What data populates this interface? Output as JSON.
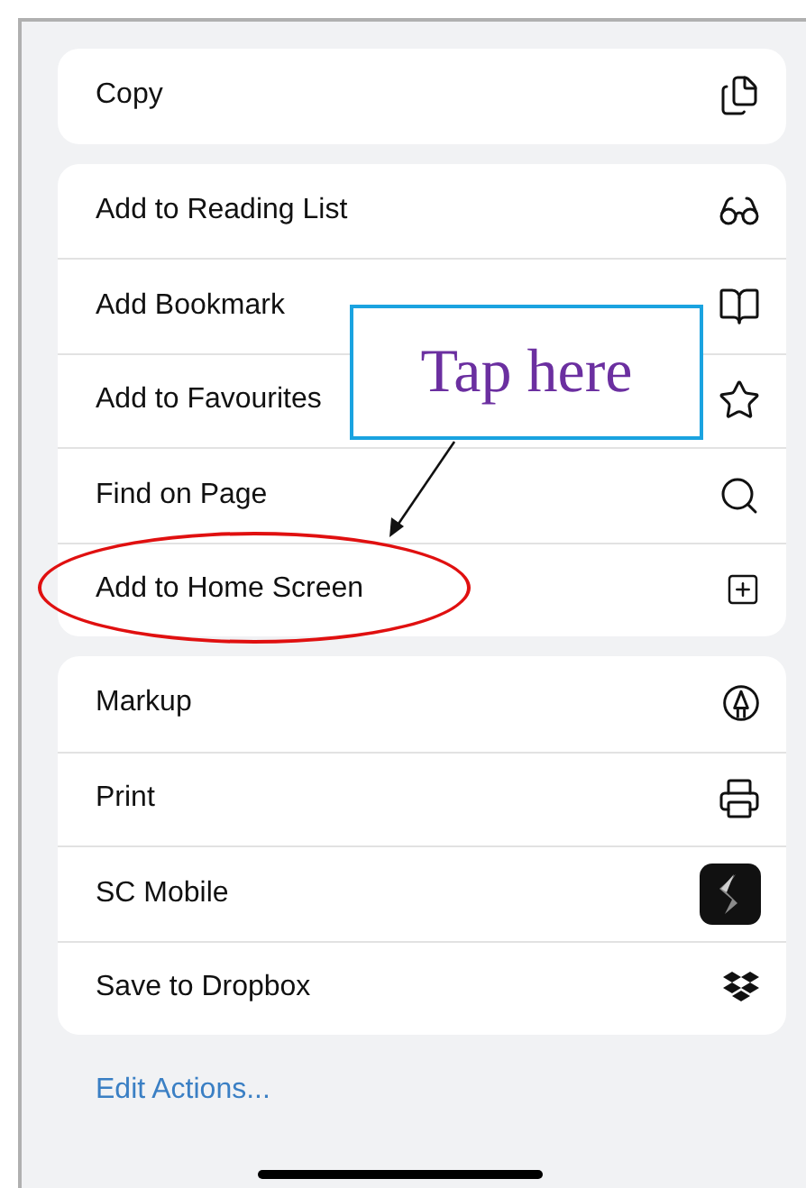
{
  "groups": [
    {
      "items": [
        {
          "label": "Copy",
          "highlighted": false
        }
      ]
    },
    {
      "items": [
        {
          "label": "Add to Reading List",
          "highlighted": false
        },
        {
          "label": "Add Bookmark",
          "highlighted": false
        },
        {
          "label": "Add to Favourites",
          "highlighted": false
        },
        {
          "label": "Find on Page",
          "highlighted": false
        },
        {
          "label": "Add to Home Screen",
          "highlighted": true
        }
      ]
    },
    {
      "items": [
        {
          "label": "Markup",
          "highlighted": false
        },
        {
          "label": "Print",
          "highlighted": false
        },
        {
          "label": "SC Mobile",
          "highlighted": false
        },
        {
          "label": "Save to Dropbox",
          "highlighted": false
        }
      ]
    }
  ],
  "callout": {
    "text": "Tap here"
  },
  "edit_actions": "Edit Actions..."
}
